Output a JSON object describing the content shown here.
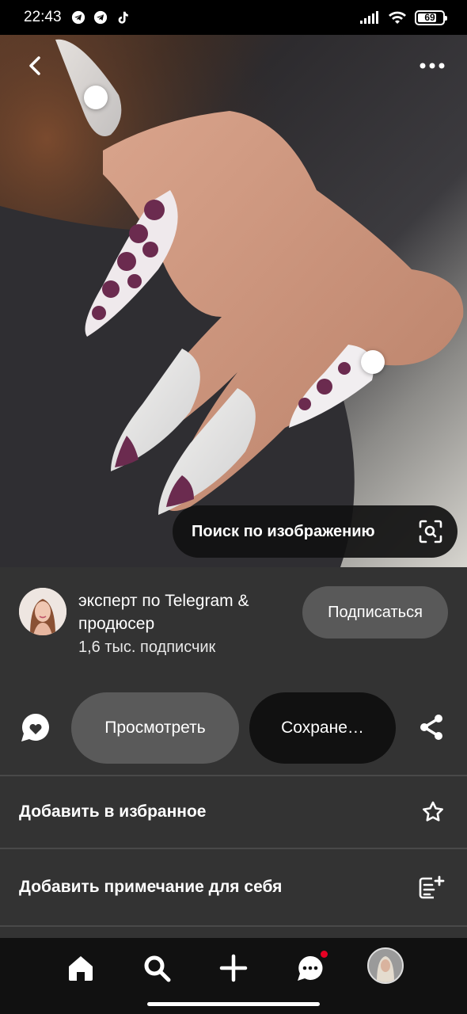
{
  "status_bar": {
    "time": "22:43",
    "left_icons": [
      "telegram-icon",
      "telegram-icon",
      "tiktok-icon"
    ],
    "right_icons": [
      "signal-icon",
      "wifi-icon",
      "battery-icon"
    ],
    "battery": "69"
  },
  "pin": {
    "image_description_icon": "nail-photo",
    "visual_search_label": "Поиск по изображению"
  },
  "creator": {
    "name": "эксперт по Telegram & продюсер",
    "followers": "1,6 тыс. подписчик",
    "follow_label": "Подписаться"
  },
  "actions": {
    "view_label": "Просмотреть",
    "save_label": "Сохране…"
  },
  "menu": {
    "favorite_label": "Добавить в избранное",
    "note_label": "Добавить примечание для себя"
  },
  "nav": {
    "items": [
      "home-icon",
      "search-icon",
      "plus-icon",
      "messages-icon",
      "profile-avatar"
    ]
  },
  "colors": {
    "background": "#333333",
    "pill_dark": "#111111",
    "pill_gray": "#5a5a5a",
    "notification": "#e60023"
  }
}
